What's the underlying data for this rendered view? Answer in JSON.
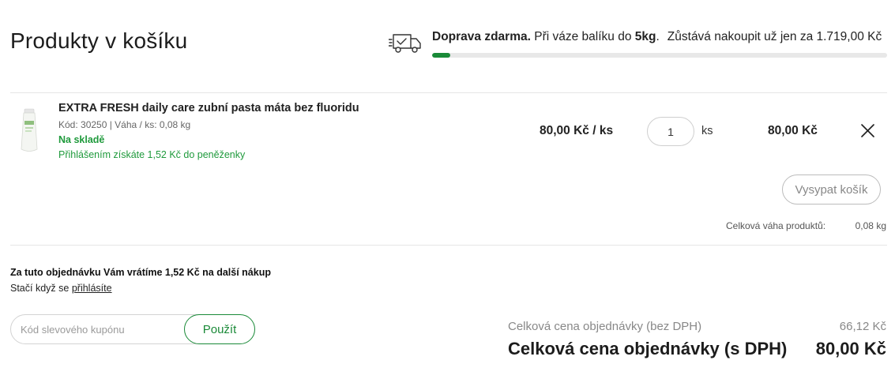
{
  "page": {
    "title": "Produkty v košíku"
  },
  "shipping": {
    "headline": "Doprava zdarma.",
    "text_before": "Při váze balíku do",
    "weight_limit": "5kg",
    "period": ".",
    "remaining": "Zůstává nakoupit už jen za 1.719,00 Kč",
    "progress_fraction": 0.04,
    "accent_color": "#1a8a38"
  },
  "cart": {
    "items": [
      {
        "name": "EXTRA FRESH daily care zubní pasta máta bez fluoridu",
        "code_weight": "Kód: 30250 | Váha / ks: 0,08 kg",
        "stock": "Na skladě",
        "wallet_bonus": "Přihlášením získáte 1,52 Kč do peněženky",
        "unit_price": "80,00 Kč / ks",
        "quantity": "1",
        "quantity_unit": "ks",
        "total": "80,00 Kč"
      }
    ],
    "empty_label": "Vysypat košík",
    "weight_label": "Celková váha produktů:",
    "weight_value": "0,08 kg"
  },
  "refund": {
    "title": "Za tuto objednávku Vám vrátíme 1,52 Kč na další nákup",
    "sub_text": "Stačí když se",
    "login_link": "přihlásíte"
  },
  "coupon": {
    "placeholder": "Kód slevového kupónu",
    "apply_label": "Použít"
  },
  "summary": {
    "net_label": "Celková cena objednávky (bez DPH)",
    "net_value": "66,12 Kč",
    "gross_label": "Celková cena objednávky (s DPH)",
    "gross_value": "80,00 Kč"
  },
  "icons": {
    "truck": "truck-icon",
    "close": "close-icon",
    "product": "product-thumbnail"
  }
}
